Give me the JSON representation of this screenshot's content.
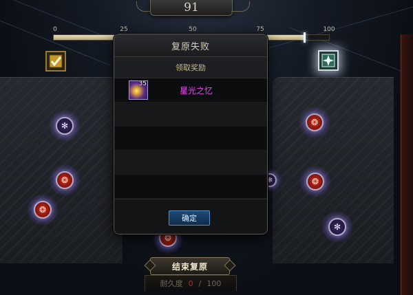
{
  "header": {
    "score": "91"
  },
  "progress": {
    "ticks": [
      "0",
      "25",
      "50",
      "75",
      "100"
    ],
    "value": 91,
    "max": 100
  },
  "reward_icons": {
    "left": "checkmark-chest-icon",
    "right": "glowing-star-chest-icon"
  },
  "modal": {
    "title": "复原失败",
    "subtitle": "领取奖励",
    "rewards": [
      {
        "count": "35",
        "name": "星光之忆",
        "icon": "starlight-memory-icon",
        "name_color": "#e04ee8"
      }
    ],
    "empty_rows": 5,
    "confirm_label": "确定"
  },
  "footer": {
    "end_button_label": "结束复原",
    "durability_label": "耐久度",
    "durability_current": "0",
    "durability_sep": "/",
    "durability_max": "100"
  },
  "nodes": [
    {
      "kind": "frost",
      "icon": "snowflake-icon"
    },
    {
      "kind": "fire",
      "icon": "flame-icon"
    },
    {
      "kind": "fire",
      "icon": "flame-icon"
    },
    {
      "kind": "fire",
      "icon": "flame-icon"
    },
    {
      "kind": "fire",
      "icon": "flame-icon"
    },
    {
      "kind": "frost",
      "icon": "snowflake-icon"
    },
    {
      "kind": "fire",
      "icon": "flame-icon"
    },
    {
      "kind": "frost",
      "icon": "snowflake-icon"
    }
  ],
  "colors": {
    "bar_fill": "#d9cba1",
    "confirm_blue": "#1f4a78",
    "item_purple": "#e04ee8",
    "durability_red": "#a6322a"
  }
}
